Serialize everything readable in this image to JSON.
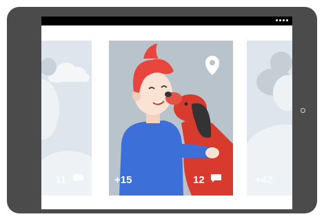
{
  "cards": {
    "left": {
      "comments": "11"
    },
    "center": {
      "extra_photos": "+15",
      "comments": "12"
    },
    "right": {
      "extra_photos": "+42"
    }
  },
  "icons": {
    "home_button": "home-button-icon",
    "location": "map-pin-icon",
    "comment": "speech-bubble-icon",
    "cloud": "cloud-icon"
  },
  "colors": {
    "tablet_body": "#4b4b4b",
    "card_bg": "#b9c3cc",
    "side_card_bg": "#dfe5ec",
    "hair": "#e8453c",
    "shirt": "#3d6fd8",
    "dog": "#d93a2e"
  }
}
